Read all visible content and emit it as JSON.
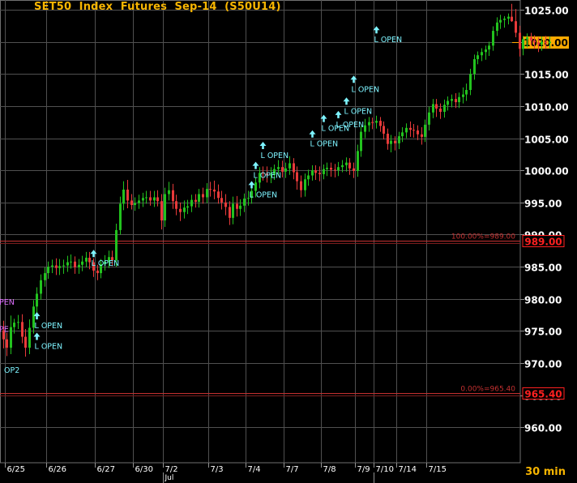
{
  "title": "SET50  Index  Futures  Sep-14  (S50U14)",
  "timeframe": "30  min",
  "colors": {
    "background": "#000000",
    "grid": "#505050",
    "axis_text": "#ffffff",
    "up_candle": "#22c21e",
    "down_candle": "#e83a3a",
    "signal": "#7ef4ff",
    "level_line": "#c43030",
    "title": "#f7b500",
    "last_price_box": "#ffaa00",
    "level_box": "#ff2020",
    "left_labels": "#e070ff"
  },
  "chart_data": {
    "type": "candlestick",
    "title": "SET50  Index  Futures  Sep-14  (S50U14)",
    "ylim": [
      954.5,
      1026.5
    ],
    "y_ticks": [
      "1025.00",
      "1020.00",
      "1015.00",
      "1010.00",
      "1005.00",
      "1000.00",
      "995.00",
      "990.00",
      "985.00",
      "980.00",
      "975.00",
      "970.00",
      "965.00",
      "960.00"
    ],
    "x_ticks": [
      "6/25",
      "6/26",
      "6/27",
      "6/30",
      "7/2",
      "7/3",
      "7/4",
      "7/7",
      "7/8",
      "7/9",
      "7/10",
      "7/14",
      "7/15"
    ],
    "month_marker": "Jul",
    "grid": true,
    "last_price": "1020.00",
    "levels": [
      {
        "label": "100.00%=989.00",
        "value": 989.0,
        "box": "989.00"
      },
      {
        "label": "0.00%=965.40",
        "value": 965.4,
        "box": "965.40"
      }
    ],
    "signals": [
      {
        "text": "L  OPEN",
        "bar": 9,
        "price": 973.6
      },
      {
        "text": "L  OPEN",
        "bar": 9,
        "price": 976.8
      },
      {
        "text": "L  OPEN",
        "bar": 24,
        "price": 986.5
      },
      {
        "text": "L  OPEN",
        "bar": 66,
        "price": 997.2
      },
      {
        "text": "L  OPEN",
        "bar": 67,
        "price": 1000.2
      },
      {
        "text": "L  OPEN",
        "bar": 69,
        "price": 1003.3
      },
      {
        "text": "L  OPEN",
        "bar": 82,
        "price": 1005.1
      },
      {
        "text": "L  OPEN",
        "bar": 85,
        "price": 1007.5
      },
      {
        "text": "L  OPEN",
        "bar": 89,
        "price": 1008.1
      },
      {
        "text": "L  OPEN",
        "bar": 91,
        "price": 1010.2
      },
      {
        "text": "L  OPEN",
        "bar": 93,
        "price": 1013.6
      },
      {
        "text": "L  OPEN",
        "bar": 99,
        "price": 1021.3
      }
    ],
    "left_edge_labels": [
      {
        "text": "PEN",
        "price": 979.6
      },
      {
        "text": "PE",
        "price": 975.4
      },
      {
        "text": "OP2",
        "price": 969.0
      }
    ],
    "candles": [
      [
        975.1,
        976.6,
        972.3,
        973.7
      ],
      [
        973.7,
        974.7,
        971.1,
        972.4
      ],
      [
        972.4,
        977.4,
        971.4,
        975.6
      ],
      [
        975.6,
        976.9,
        974.6,
        976.3
      ],
      [
        976.3,
        977.5,
        975.3,
        976.4
      ],
      [
        976.4,
        977.6,
        973.1,
        974.1
      ],
      [
        974.1,
        975.3,
        971.0,
        972.4
      ],
      [
        972.4,
        976.8,
        971.4,
        975.5
      ],
      [
        975.5,
        979.8,
        974.6,
        978.8
      ],
      [
        978.8,
        981.8,
        977.8,
        980.8
      ],
      [
        980.8,
        983.8,
        979.9,
        982.9
      ],
      [
        982.9,
        984.9,
        981.9,
        984.0
      ],
      [
        984.0,
        985.8,
        983.1,
        985.0
      ],
      [
        985.0,
        986.1,
        984.0,
        985.2
      ],
      [
        985.2,
        986.3,
        983.7,
        984.8
      ],
      [
        984.8,
        986.2,
        983.7,
        985.1
      ],
      [
        985.1,
        986.1,
        983.9,
        985.2
      ],
      [
        985.2,
        986.7,
        984.2,
        985.7
      ],
      [
        985.7,
        986.9,
        984.7,
        985.8
      ],
      [
        985.8,
        986.6,
        983.9,
        984.9
      ],
      [
        984.9,
        986.2,
        983.9,
        985.3
      ],
      [
        985.3,
        986.7,
        984.3,
        985.8
      ],
      [
        985.8,
        987.3,
        984.9,
        986.4
      ],
      [
        986.4,
        987.3,
        984.6,
        985.7
      ],
      [
        985.7,
        986.3,
        983.4,
        984.4
      ],
      [
        984.4,
        985.3,
        982.9,
        984.0
      ],
      [
        984.0,
        986.2,
        983.2,
        985.4
      ],
      [
        985.4,
        986.8,
        984.4,
        985.8
      ],
      [
        985.8,
        987.5,
        984.8,
        986.5
      ],
      [
        986.5,
        987.5,
        985.1,
        986.0
      ],
      [
        986.0,
        991.7,
        985.0,
        990.7
      ],
      [
        990.7,
        995.9,
        990.0,
        994.8
      ],
      [
        994.8,
        998.3,
        993.8,
        997.0
      ],
      [
        997.0,
        998.5,
        994.1,
        995.3
      ],
      [
        995.3,
        996.3,
        993.9,
        994.6
      ],
      [
        994.6,
        995.8,
        993.7,
        994.9
      ],
      [
        994.9,
        996.2,
        994.0,
        995.3
      ],
      [
        995.3,
        996.5,
        994.3,
        995.7
      ],
      [
        995.7,
        996.8,
        994.8,
        995.8
      ],
      [
        995.8,
        996.8,
        994.5,
        995.3
      ],
      [
        995.3,
        996.8,
        994.3,
        995.8
      ],
      [
        995.8,
        996.9,
        994.4,
        995.2
      ],
      [
        995.2,
        996.3,
        990.8,
        992.2
      ],
      [
        992.2,
        997.3,
        991.2,
        996.3
      ],
      [
        996.3,
        998.2,
        995.3,
        996.9
      ],
      [
        996.9,
        997.9,
        994.0,
        995.2
      ],
      [
        995.2,
        996.2,
        993.0,
        994.0
      ],
      [
        994.0,
        995.0,
        992.1,
        993.5
      ],
      [
        993.5,
        995.3,
        992.5,
        994.2
      ],
      [
        994.2,
        995.4,
        993.2,
        994.4
      ],
      [
        994.4,
        996.2,
        993.5,
        995.4
      ],
      [
        995.4,
        996.3,
        994.2,
        995.1
      ],
      [
        995.1,
        997.1,
        994.2,
        996.3
      ],
      [
        996.3,
        997.3,
        994.8,
        995.8
      ],
      [
        995.8,
        998.0,
        994.9,
        997.1
      ],
      [
        997.1,
        998.2,
        995.9,
        997.0
      ],
      [
        997.0,
        998.4,
        995.5,
        996.7
      ],
      [
        996.7,
        997.8,
        994.8,
        995.7
      ],
      [
        995.7,
        996.8,
        993.9,
        995.0
      ],
      [
        995.0,
        996.3,
        993.0,
        994.3
      ],
      [
        994.3,
        995.2,
        991.5,
        992.6
      ],
      [
        992.6,
        995.9,
        991.6,
        994.8
      ],
      [
        994.8,
        996.0,
        992.8,
        994.0
      ],
      [
        994.0,
        995.5,
        992.9,
        994.5
      ],
      [
        994.5,
        996.4,
        993.5,
        995.6
      ],
      [
        995.6,
        996.8,
        994.5,
        995.7
      ],
      [
        995.7,
        997.5,
        994.8,
        996.8
      ],
      [
        996.8,
        998.9,
        995.8,
        998.1
      ],
      [
        998.1,
        1000.5,
        997.2,
        999.6
      ],
      [
        999.6,
        1000.6,
        998.4,
        999.5
      ],
      [
        999.5,
        1000.6,
        998.1,
        999.2
      ],
      [
        999.2,
        1000.5,
        998.0,
        999.3
      ],
      [
        999.3,
        1000.9,
        998.5,
        1000.2
      ],
      [
        1000.2,
        1001.6,
        999.1,
        1000.5
      ],
      [
        1000.5,
        1001.5,
        998.9,
        999.8
      ],
      [
        999.8,
        1001.2,
        998.8,
        1000.3
      ],
      [
        1000.3,
        1002.2,
        999.3,
        1001.1
      ],
      [
        1001.1,
        1001.9,
        998.6,
        999.7
      ],
      [
        999.7,
        1000.6,
        997.0,
        998.3
      ],
      [
        998.3,
        999.2,
        995.8,
        996.9
      ],
      [
        996.9,
        999.5,
        995.9,
        998.6
      ],
      [
        998.6,
        1000.1,
        997.6,
        999.2
      ],
      [
        999.2,
        1000.8,
        998.4,
        1000.0
      ],
      [
        1000.0,
        1000.8,
        998.5,
        999.6
      ],
      [
        999.6,
        1000.6,
        998.3,
        999.4
      ],
      [
        999.4,
        1000.9,
        998.6,
        1000.2
      ],
      [
        1000.2,
        1001.2,
        999.1,
        1000.4
      ],
      [
        1000.4,
        1001.2,
        999.0,
        1000.1
      ],
      [
        1000.1,
        1001.0,
        998.9,
        1000.0
      ],
      [
        1000.0,
        1001.3,
        999.1,
        1000.5
      ],
      [
        1000.5,
        1001.6,
        999.7,
        1000.8
      ],
      [
        1000.8,
        1002.0,
        999.8,
        1001.2
      ],
      [
        1001.2,
        1001.9,
        999.3,
        1000.3
      ],
      [
        1000.3,
        1001.2,
        998.8,
        999.9
      ],
      [
        999.9,
        1004.0,
        999.0,
        1003.0
      ],
      [
        1003.0,
        1006.9,
        1002.1,
        1006.0
      ],
      [
        1006.0,
        1008.0,
        1005.0,
        1007.0
      ],
      [
        1007.0,
        1008.3,
        1006.0,
        1007.5
      ],
      [
        1007.5,
        1008.2,
        1006.4,
        1007.4
      ],
      [
        1007.4,
        1008.5,
        1006.5,
        1007.7
      ],
      [
        1007.7,
        1008.3,
        1006.0,
        1006.9
      ],
      [
        1006.9,
        1007.6,
        1004.8,
        1005.7
      ],
      [
        1005.7,
        1006.5,
        1003.2,
        1004.1
      ],
      [
        1004.1,
        1005.5,
        1002.8,
        1004.6
      ],
      [
        1004.6,
        1005.3,
        1003.1,
        1004.2
      ],
      [
        1004.2,
        1006.0,
        1003.3,
        1005.3
      ],
      [
        1005.3,
        1006.7,
        1004.4,
        1005.9
      ],
      [
        1005.9,
        1007.3,
        1005.0,
        1006.6
      ],
      [
        1006.6,
        1007.6,
        1005.2,
        1006.3
      ],
      [
        1006.3,
        1007.2,
        1005.1,
        1006.2
      ],
      [
        1006.2,
        1007.0,
        1004.7,
        1005.6
      ],
      [
        1005.6,
        1006.7,
        1004.0,
        1005.2
      ],
      [
        1005.2,
        1007.9,
        1004.4,
        1007.1
      ],
      [
        1007.1,
        1009.9,
        1006.2,
        1009.0
      ],
      [
        1009.0,
        1011.1,
        1008.1,
        1010.3
      ],
      [
        1010.3,
        1011.1,
        1008.3,
        1009.6
      ],
      [
        1009.6,
        1010.4,
        1008.0,
        1009.1
      ],
      [
        1009.1,
        1011.0,
        1008.2,
        1010.2
      ],
      [
        1010.2,
        1011.5,
        1009.3,
        1010.8
      ],
      [
        1010.8,
        1011.8,
        1009.8,
        1011.1
      ],
      [
        1011.1,
        1012.0,
        1009.7,
        1010.6
      ],
      [
        1010.6,
        1012.1,
        1009.7,
        1011.4
      ],
      [
        1011.4,
        1012.9,
        1010.4,
        1011.8
      ],
      [
        1011.8,
        1013.5,
        1010.8,
        1012.5
      ],
      [
        1012.5,
        1015.8,
        1011.7,
        1015.0
      ],
      [
        1015.0,
        1018.0,
        1014.1,
        1017.3
      ],
      [
        1017.3,
        1018.5,
        1016.5,
        1017.9
      ],
      [
        1017.9,
        1019.0,
        1017.0,
        1018.4
      ],
      [
        1018.4,
        1019.4,
        1017.2,
        1018.8
      ],
      [
        1018.8,
        1020.0,
        1017.8,
        1019.4
      ],
      [
        1019.4,
        1022.4,
        1018.6,
        1021.7
      ],
      [
        1021.7,
        1023.8,
        1020.9,
        1023.0
      ],
      [
        1023.0,
        1024.2,
        1022.0,
        1023.4
      ],
      [
        1023.4,
        1024.0,
        1022.2,
        1023.6
      ],
      [
        1023.6,
        1024.4,
        1022.7,
        1023.9
      ],
      [
        1023.9,
        1025.9,
        1023.1,
        1023.2
      ],
      [
        1023.2,
        1025.1,
        1020.7,
        1021.4
      ],
      [
        1021.4,
        1022.5,
        1017.7,
        1018.9
      ],
      [
        1018.9,
        1020.9,
        1017.9,
        1020.4
      ],
      [
        1020.4,
        1021.3,
        1019.1,
        1020.7
      ],
      [
        1020.7,
        1021.4,
        1019.5,
        1020.2
      ],
      [
        1020.2,
        1021.0,
        1018.9,
        1019.9
      ],
      [
        1019.9,
        1020.7,
        1018.4,
        1019.6
      ],
      [
        1019.6,
        1020.8,
        1018.6,
        1020.0
      ],
      [
        1020.0,
        1020.9,
        1018.9,
        1019.8
      ],
      [
        1019.8,
        1020.8,
        1019.0,
        1020.0
      ]
    ]
  }
}
